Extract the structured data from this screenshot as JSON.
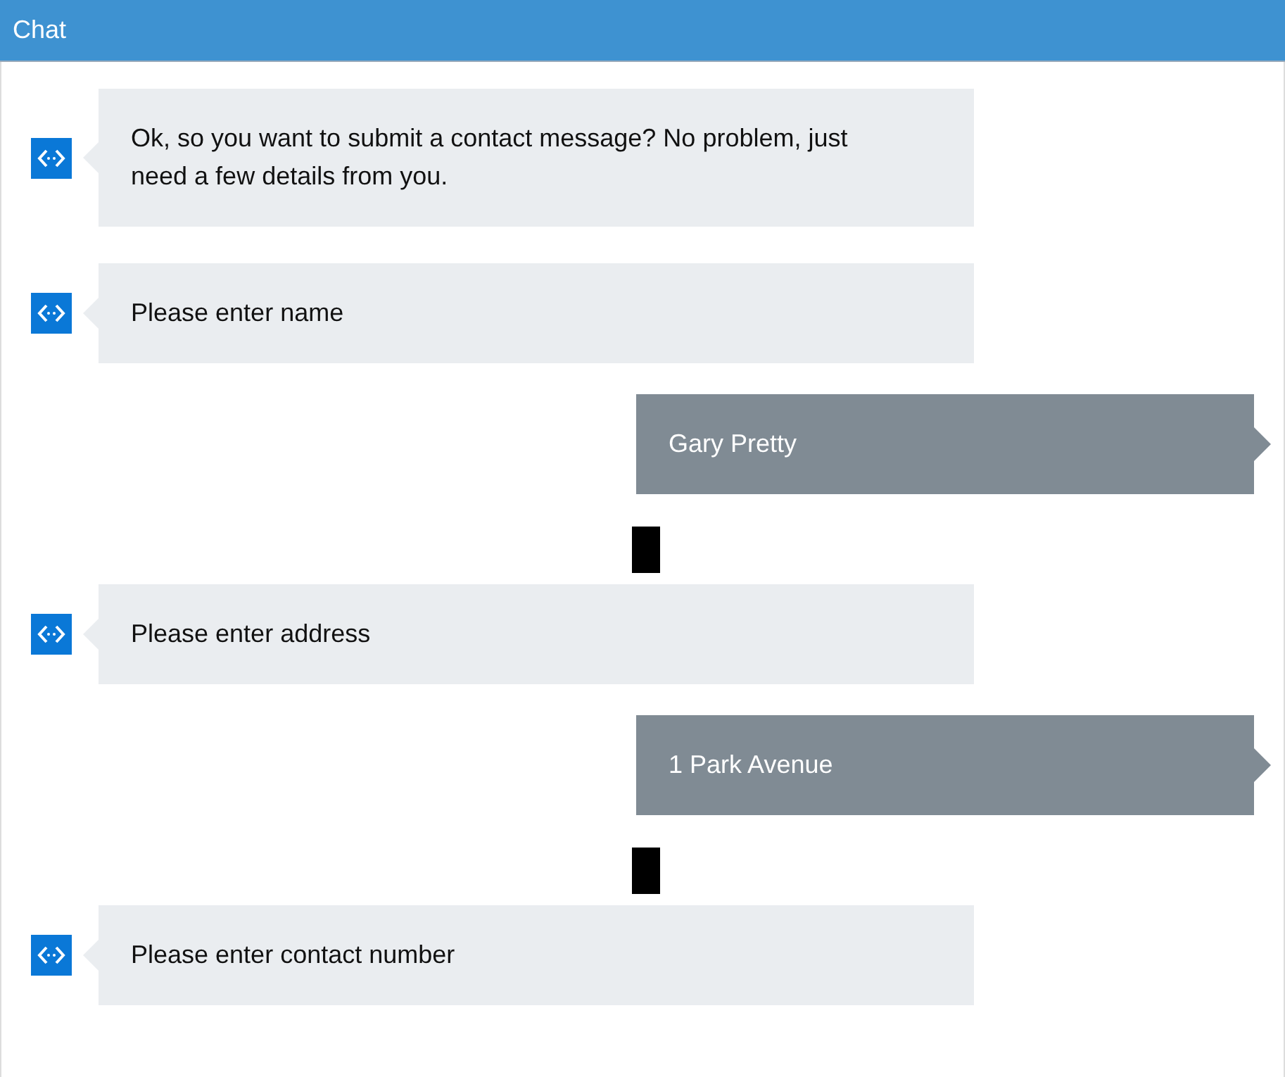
{
  "header": {
    "title": "Chat"
  },
  "messages": [
    {
      "kind": "bot",
      "text": "Ok, so you want to submit a contact message? No problem, just need a few details from you."
    },
    {
      "kind": "bot",
      "text": "Please enter name"
    },
    {
      "kind": "user",
      "text": "Gary Pretty"
    },
    {
      "kind": "marker"
    },
    {
      "kind": "bot",
      "text": "Please enter address"
    },
    {
      "kind": "user",
      "text": "1 Park Avenue"
    },
    {
      "kind": "marker"
    },
    {
      "kind": "bot",
      "text": "Please enter contact number"
    }
  ]
}
